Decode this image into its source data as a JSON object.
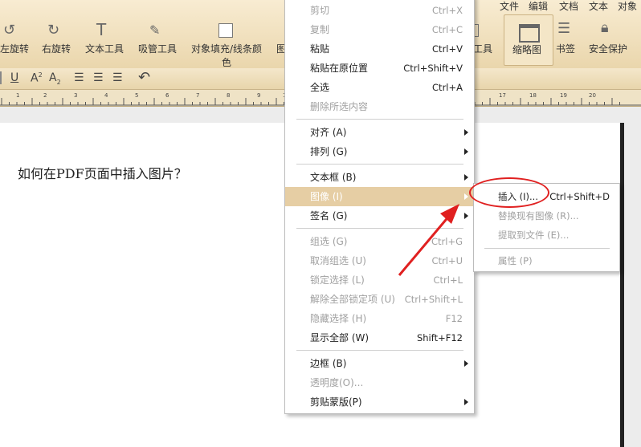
{
  "top_menu": [
    "文件",
    "编辑",
    "文档",
    "文本",
    "对象"
  ],
  "toolbar": {
    "rotate_left": "左旋转",
    "rotate_right": "右旋转",
    "text_tool": "文本工具",
    "eyedropper": "吸管工具",
    "fill_line_l1": "对象填充/线条颜",
    "fill_line_l2": "色",
    "partial_pic": "图",
    "partial_tool": "工具",
    "thumbnail": "缩略图",
    "bookmark": "书签",
    "security": "安全保护"
  },
  "format_bar": {
    "underline": "U",
    "superscript": "A",
    "subscript": "A"
  },
  "ruler": [
    "1",
    "2",
    "3",
    "4",
    "5",
    "6",
    "7",
    "8",
    "9",
    "10",
    "17",
    "18",
    "19",
    "20"
  ],
  "document": {
    "text": "如何在PDF页面中插入图片？"
  },
  "context_menu": {
    "cut": {
      "label": "剪切",
      "shortcut": "Ctrl+X"
    },
    "copy": {
      "label": "复制",
      "shortcut": "Ctrl+C"
    },
    "paste": {
      "label": "粘贴",
      "shortcut": "Ctrl+V"
    },
    "paste_in_place": {
      "label": "粘贴在原位置",
      "shortcut": "Ctrl+Shift+V"
    },
    "select_all": {
      "label": "全选",
      "shortcut": "Ctrl+A"
    },
    "delete_selected": {
      "label": "删除所选内容"
    },
    "align": {
      "label": "对齐 (A)"
    },
    "arrange": {
      "label": "排列 (G)"
    },
    "textbox": {
      "label": "文本框 (B)"
    },
    "image": {
      "label": "图像 (I)"
    },
    "signature": {
      "label": "签名 (G)"
    },
    "group": {
      "label": "组选 (G)",
      "shortcut": "Ctrl+G"
    },
    "ungroup": {
      "label": "取消组选 (U)",
      "shortcut": "Ctrl+U"
    },
    "lock": {
      "label": "锁定选择 (L)",
      "shortcut": "Ctrl+L"
    },
    "unlock_all": {
      "label": "解除全部锁定项 (U)",
      "shortcut": "Ctrl+Shift+L"
    },
    "hide": {
      "label": "隐藏选择 (H)",
      "shortcut": "F12"
    },
    "show_all": {
      "label": "显示全部 (W)",
      "shortcut": "Shift+F12"
    },
    "border": {
      "label": "边框 (B)"
    },
    "opacity": {
      "label": "透明度(O)..."
    },
    "clipping_mask": {
      "label": "剪贴蒙版(P)"
    }
  },
  "image_submenu": {
    "insert": {
      "label": "插入 (I)...",
      "shortcut": "Ctrl+Shift+D"
    },
    "replace": {
      "label": "替换现有图像 (R)..."
    },
    "extract": {
      "label": "提取到文件 (E)..."
    },
    "properties": {
      "label": "属性 (P)"
    }
  },
  "colors": {
    "highlight": "#e6cea4",
    "annotation": "#e02020",
    "toolbar": "#f1e2c2"
  }
}
